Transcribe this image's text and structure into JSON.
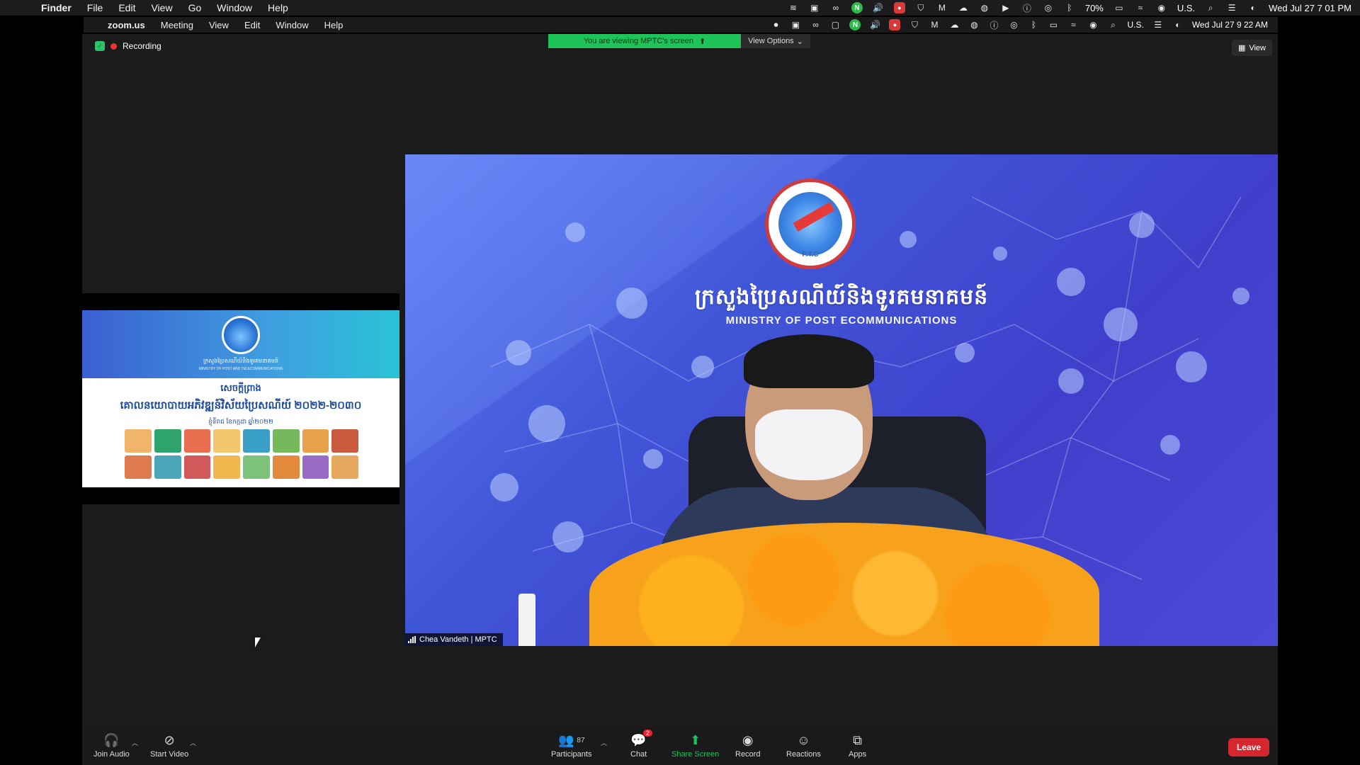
{
  "outer_menubar": {
    "app": "Finder",
    "items": [
      "File",
      "Edit",
      "View",
      "Go",
      "Window",
      "Help"
    ],
    "battery": "70%",
    "input": "U.S.",
    "clock": "Wed Jul 27  7 01 PM"
  },
  "inner_menubar": {
    "app": "zoom.us",
    "items": [
      "Meeting",
      "View",
      "Edit",
      "Window",
      "Help"
    ],
    "input": "U.S.",
    "clock": "Wed Jul 27  9 22 AM"
  },
  "meeting": {
    "recording_label": "Recording",
    "banner_text": "You are viewing MPTC's screen",
    "view_options_label": "View Options",
    "view_label": "View"
  },
  "slide": {
    "header_kh": "ក្រសួងប្រៃសណីយ៍និងទូរគមនាគមន៍",
    "header_en": "MINISTRY OF POST AND TELECOMMUNICATIONS",
    "title1": "សេចក្តីព្រាង",
    "title2": "គោលនយោបាយអភិវឌ្ឍន៍វិស័យប្រៃសណីយ៍ ២០២២-២០៣០",
    "title3": "ខ្ញុំទីរាជ ខែកក្កដា ឆ្នាំ២០២២"
  },
  "video": {
    "kh_title": "ក្រសួងប្រៃសណីយ៍និងទូរគមនាគមន៍",
    "en_title": "MINISTRY OF POST ECOMMUNICATIONS",
    "emblem_text": "P.T.C",
    "speaker_name": "Chea Vandeth | MPTC"
  },
  "toolbar": {
    "join_audio": "Join Audio",
    "start_video": "Start Video",
    "participants": "Participants",
    "participants_count": "87",
    "chat": "Chat",
    "chat_badge": "2",
    "share_screen": "Share Screen",
    "record": "Record",
    "reactions": "Reactions",
    "apps": "Apps",
    "leave": "Leave"
  },
  "colors": {
    "share_green": "#1fc15b",
    "leave_red": "#d6262f",
    "stage_bg": "#1b1b1b"
  }
}
